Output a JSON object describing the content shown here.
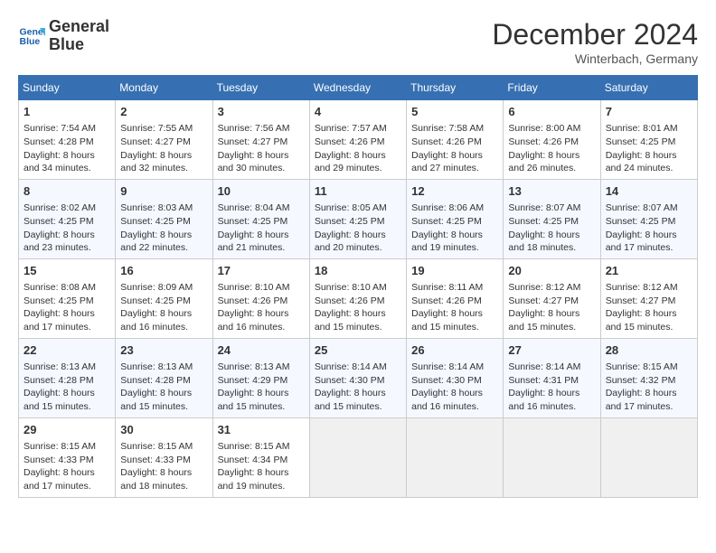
{
  "logo": {
    "line1": "General",
    "line2": "Blue"
  },
  "title": "December 2024",
  "location": "Winterbach, Germany",
  "days_of_week": [
    "Sunday",
    "Monday",
    "Tuesday",
    "Wednesday",
    "Thursday",
    "Friday",
    "Saturday"
  ],
  "weeks": [
    [
      {
        "day": "1",
        "sunrise": "7:54 AM",
        "sunset": "4:28 PM",
        "daylight": "8 hours and 34 minutes."
      },
      {
        "day": "2",
        "sunrise": "7:55 AM",
        "sunset": "4:27 PM",
        "daylight": "8 hours and 32 minutes."
      },
      {
        "day": "3",
        "sunrise": "7:56 AM",
        "sunset": "4:27 PM",
        "daylight": "8 hours and 30 minutes."
      },
      {
        "day": "4",
        "sunrise": "7:57 AM",
        "sunset": "4:26 PM",
        "daylight": "8 hours and 29 minutes."
      },
      {
        "day": "5",
        "sunrise": "7:58 AM",
        "sunset": "4:26 PM",
        "daylight": "8 hours and 27 minutes."
      },
      {
        "day": "6",
        "sunrise": "8:00 AM",
        "sunset": "4:26 PM",
        "daylight": "8 hours and 26 minutes."
      },
      {
        "day": "7",
        "sunrise": "8:01 AM",
        "sunset": "4:25 PM",
        "daylight": "8 hours and 24 minutes."
      }
    ],
    [
      {
        "day": "8",
        "sunrise": "8:02 AM",
        "sunset": "4:25 PM",
        "daylight": "8 hours and 23 minutes."
      },
      {
        "day": "9",
        "sunrise": "8:03 AM",
        "sunset": "4:25 PM",
        "daylight": "8 hours and 22 minutes."
      },
      {
        "day": "10",
        "sunrise": "8:04 AM",
        "sunset": "4:25 PM",
        "daylight": "8 hours and 21 minutes."
      },
      {
        "day": "11",
        "sunrise": "8:05 AM",
        "sunset": "4:25 PM",
        "daylight": "8 hours and 20 minutes."
      },
      {
        "day": "12",
        "sunrise": "8:06 AM",
        "sunset": "4:25 PM",
        "daylight": "8 hours and 19 minutes."
      },
      {
        "day": "13",
        "sunrise": "8:07 AM",
        "sunset": "4:25 PM",
        "daylight": "8 hours and 18 minutes."
      },
      {
        "day": "14",
        "sunrise": "8:07 AM",
        "sunset": "4:25 PM",
        "daylight": "8 hours and 17 minutes."
      }
    ],
    [
      {
        "day": "15",
        "sunrise": "8:08 AM",
        "sunset": "4:25 PM",
        "daylight": "8 hours and 17 minutes."
      },
      {
        "day": "16",
        "sunrise": "8:09 AM",
        "sunset": "4:25 PM",
        "daylight": "8 hours and 16 minutes."
      },
      {
        "day": "17",
        "sunrise": "8:10 AM",
        "sunset": "4:26 PM",
        "daylight": "8 hours and 16 minutes."
      },
      {
        "day": "18",
        "sunrise": "8:10 AM",
        "sunset": "4:26 PM",
        "daylight": "8 hours and 15 minutes."
      },
      {
        "day": "19",
        "sunrise": "8:11 AM",
        "sunset": "4:26 PM",
        "daylight": "8 hours and 15 minutes."
      },
      {
        "day": "20",
        "sunrise": "8:12 AM",
        "sunset": "4:27 PM",
        "daylight": "8 hours and 15 minutes."
      },
      {
        "day": "21",
        "sunrise": "8:12 AM",
        "sunset": "4:27 PM",
        "daylight": "8 hours and 15 minutes."
      }
    ],
    [
      {
        "day": "22",
        "sunrise": "8:13 AM",
        "sunset": "4:28 PM",
        "daylight": "8 hours and 15 minutes."
      },
      {
        "day": "23",
        "sunrise": "8:13 AM",
        "sunset": "4:28 PM",
        "daylight": "8 hours and 15 minutes."
      },
      {
        "day": "24",
        "sunrise": "8:13 AM",
        "sunset": "4:29 PM",
        "daylight": "8 hours and 15 minutes."
      },
      {
        "day": "25",
        "sunrise": "8:14 AM",
        "sunset": "4:30 PM",
        "daylight": "8 hours and 15 minutes."
      },
      {
        "day": "26",
        "sunrise": "8:14 AM",
        "sunset": "4:30 PM",
        "daylight": "8 hours and 16 minutes."
      },
      {
        "day": "27",
        "sunrise": "8:14 AM",
        "sunset": "4:31 PM",
        "daylight": "8 hours and 16 minutes."
      },
      {
        "day": "28",
        "sunrise": "8:15 AM",
        "sunset": "4:32 PM",
        "daylight": "8 hours and 17 minutes."
      }
    ],
    [
      {
        "day": "29",
        "sunrise": "8:15 AM",
        "sunset": "4:33 PM",
        "daylight": "8 hours and 17 minutes."
      },
      {
        "day": "30",
        "sunrise": "8:15 AM",
        "sunset": "4:33 PM",
        "daylight": "8 hours and 18 minutes."
      },
      {
        "day": "31",
        "sunrise": "8:15 AM",
        "sunset": "4:34 PM",
        "daylight": "8 hours and 19 minutes."
      },
      null,
      null,
      null,
      null
    ]
  ],
  "labels": {
    "sunrise": "Sunrise:",
    "sunset": "Sunset:",
    "daylight": "Daylight:"
  }
}
